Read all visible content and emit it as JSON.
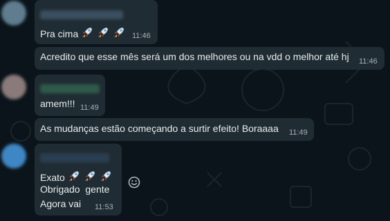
{
  "messages": [
    {
      "text": "Pra cima",
      "emoji": [
        "rocket",
        "rocket",
        "rocket"
      ],
      "time": "11:46"
    },
    {
      "text": "Acredito que esse mês será um dos melhores ou na vdd o melhor até hj",
      "time": "11:46"
    },
    {
      "text": "amem!!!",
      "time": "11:49"
    },
    {
      "text": "As mudanças estão começando a surtir efeito! Boraaaa",
      "time": "11:49"
    },
    {
      "line1": "Exato",
      "line1_emoji": [
        "rocket",
        "rocket",
        "rocket"
      ],
      "line2": "Obrigado  gente",
      "line3": "Agora vai",
      "time": "11:53"
    }
  ],
  "icons": {
    "rocket": "rocket-icon",
    "react": "emoji-reaction-icon"
  },
  "colors": {
    "background": "#0b141a",
    "bubble": "#202c33",
    "text": "#e9edef",
    "timestamp": "#a8b0b5"
  }
}
